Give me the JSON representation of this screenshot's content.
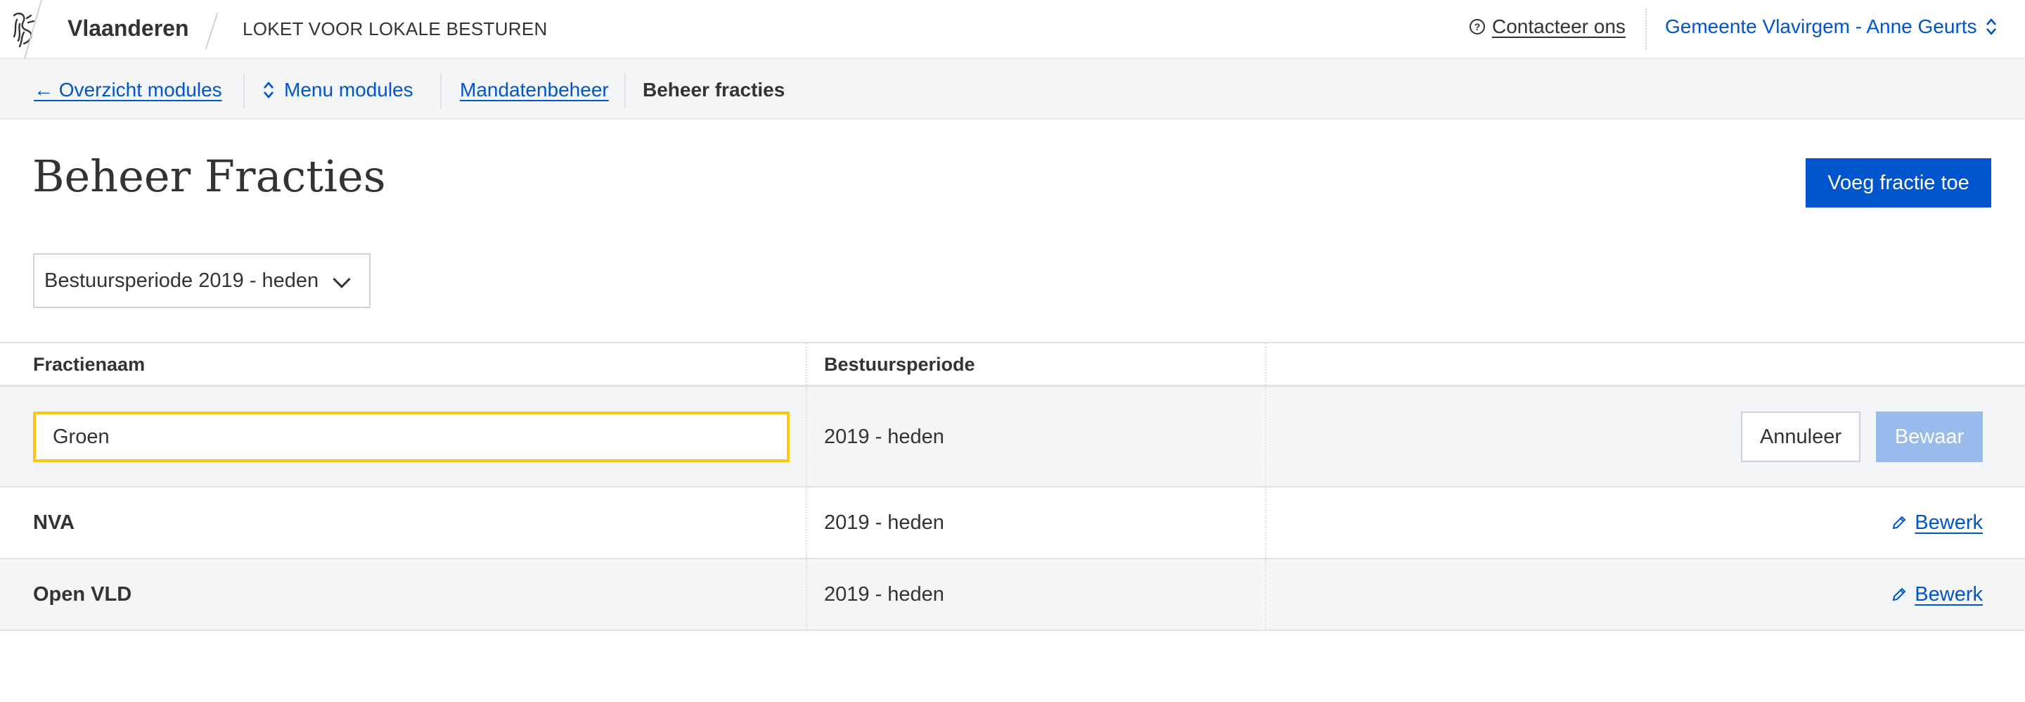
{
  "header": {
    "brand": "Vlaanderen",
    "product": "LOKET VOOR LOKALE BESTUREN",
    "contact": "Contacteer ons",
    "user": "Gemeente Vlavirgem - Anne Geurts"
  },
  "subnav": {
    "back": "← Overzicht modules",
    "menu": "Menu modules",
    "section": "Mandatenbeheer",
    "current": "Beheer fracties"
  },
  "page": {
    "title": "Beheer Fracties",
    "add_button": "Voeg fractie toe",
    "period_select": "Bestuursperiode 2019 - heden"
  },
  "table": {
    "headers": [
      "Fractienaam",
      "Bestuursperiode",
      ""
    ],
    "edit_row": {
      "name_value": "Groen",
      "period": "2019 - heden",
      "cancel": "Annuleer",
      "save": "Bewaar"
    },
    "rows": [
      {
        "name": "NVA",
        "period": "2019 - heden",
        "action": "Bewerk"
      },
      {
        "name": "Open VLD",
        "period": "2019 - heden",
        "action": "Bewerk"
      }
    ]
  },
  "colors": {
    "primary": "#0055cc",
    "focus": "#ffc515",
    "disabled": "#99bbeb",
    "alt_row": "#f3f5f6",
    "text": "#333332"
  }
}
